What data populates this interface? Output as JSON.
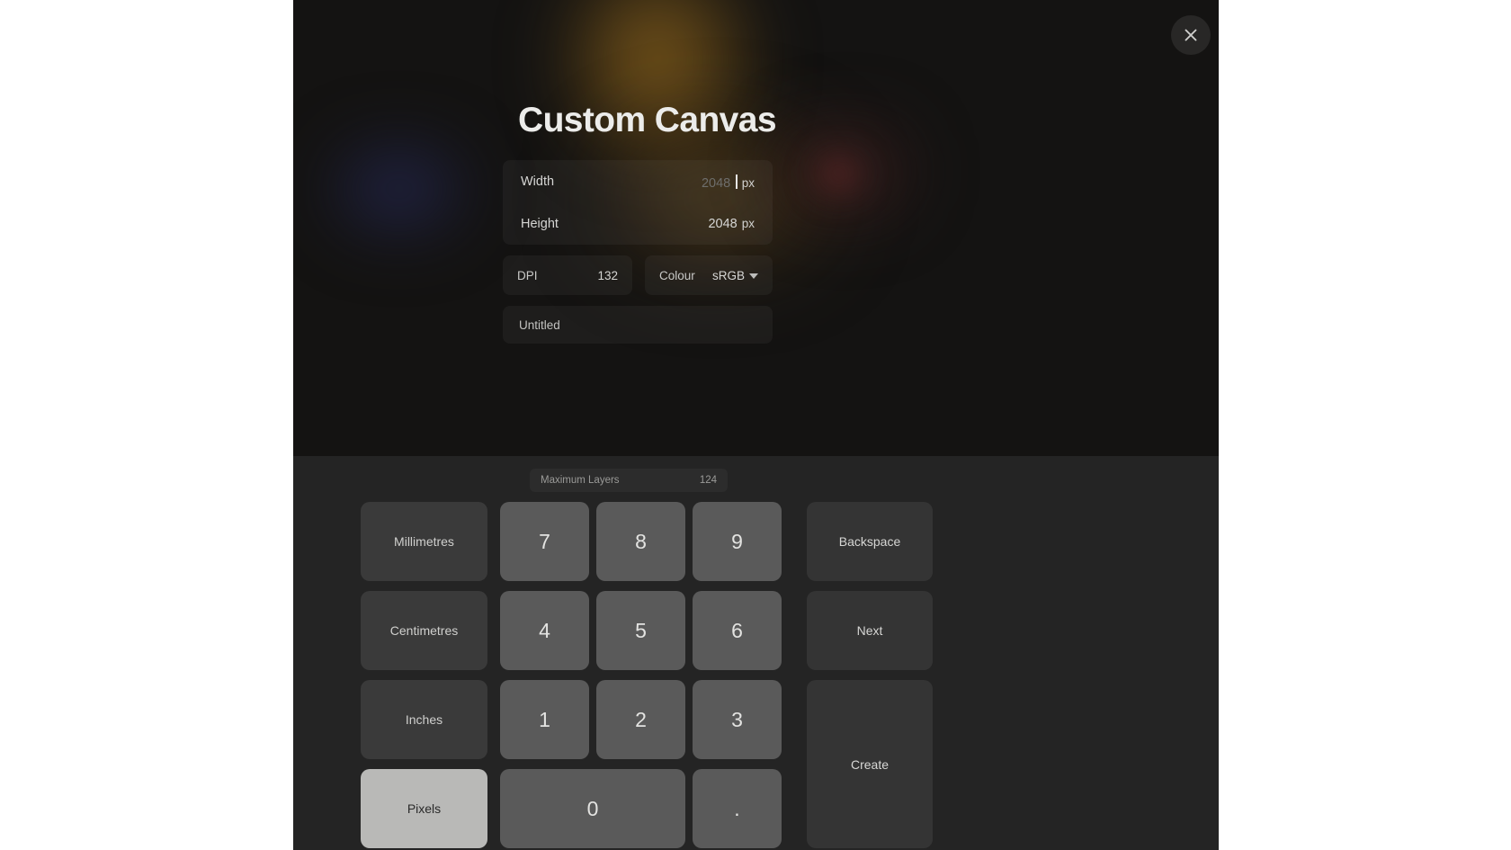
{
  "modal": {
    "title": "Custom Canvas",
    "close_icon": "close-icon"
  },
  "form": {
    "width": {
      "label": "Width",
      "value": "2048",
      "unit": "px"
    },
    "height": {
      "label": "Height",
      "value": "2048",
      "unit": "px"
    },
    "dpi": {
      "label": "DPI",
      "value": "132"
    },
    "colour": {
      "label": "Colour",
      "value": "sRGB",
      "chevron_icon": "chevron-down-icon"
    },
    "name": {
      "value": "Untitled"
    }
  },
  "max_layers": {
    "label": "Maximum Layers",
    "value": "124"
  },
  "keypad": {
    "units": [
      {
        "label": "Millimetres",
        "selected": false
      },
      {
        "label": "Centimetres",
        "selected": false
      },
      {
        "label": "Inches",
        "selected": false
      },
      {
        "label": "Pixels",
        "selected": true
      }
    ],
    "digits": {
      "d7": "7",
      "d8": "8",
      "d9": "9",
      "d4": "4",
      "d5": "5",
      "d6": "6",
      "d1": "1",
      "d2": "2",
      "d3": "3",
      "d0": "0",
      "dot": "."
    },
    "actions": {
      "backspace": "Backspace",
      "next": "Next",
      "create": "Create"
    }
  },
  "colors": {
    "modal_top_bg": "#141312",
    "modal_bottom_bg": "#242424",
    "key_num_bg": "#5a5a5a",
    "key_unit_bg": "#3a3a3a",
    "key_unit_active_bg": "#b9b9b7",
    "page_bg": "#ffffff"
  }
}
